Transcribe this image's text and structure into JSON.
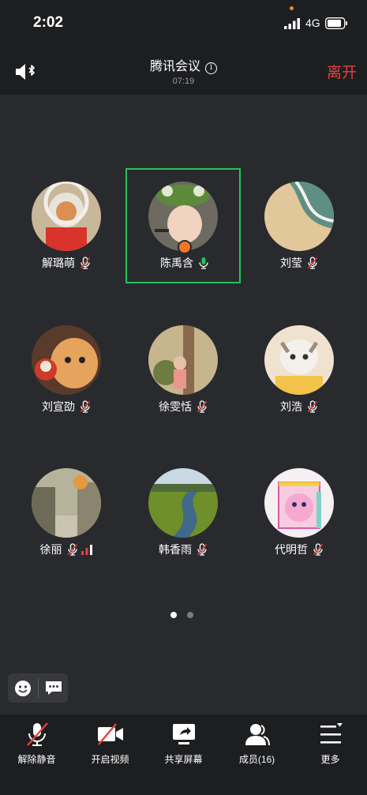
{
  "status_bar": {
    "time": "2:02",
    "network": "4G",
    "signal_icon": "cellular-signal-icon",
    "battery_icon": "battery-icon"
  },
  "header": {
    "title": "腾讯会议",
    "duration": "07:19",
    "leave_label": "离开",
    "speaker_icon": "speaker-bluetooth-icon",
    "info_icon": "info-icon"
  },
  "participants": [
    {
      "name": "解璐萌",
      "mic": "muted",
      "active": false,
      "host": false
    },
    {
      "name": "陈禹含",
      "mic": "on",
      "active": true,
      "host": true
    },
    {
      "name": "刘莹",
      "mic": "muted",
      "active": false,
      "host": false
    },
    {
      "name": "刘宣劭",
      "mic": "muted",
      "active": false,
      "host": false
    },
    {
      "name": "徐雯恬",
      "mic": "muted",
      "active": false,
      "host": false
    },
    {
      "name": "刘浩",
      "mic": "muted",
      "active": false,
      "host": false
    },
    {
      "name": "徐丽",
      "mic": "muted",
      "active": false,
      "host": false,
      "network_weak": true
    },
    {
      "name": "韩香雨",
      "mic": "muted",
      "active": false,
      "host": false
    },
    {
      "name": "代明哲",
      "mic": "muted",
      "active": false,
      "host": false
    }
  ],
  "pager": {
    "current": 1,
    "total": 2
  },
  "toolbar": {
    "unmute_label": "解除静音",
    "video_label": "开启视频",
    "share_label": "共享屏幕",
    "members_label": "成员(16)",
    "more_label": "更多"
  },
  "colors": {
    "accent_active": "#22c35a",
    "leave": "#e8413b",
    "muted": "#e8413b",
    "mic_on": "#22c35a",
    "host_badge": "#f0762c"
  }
}
